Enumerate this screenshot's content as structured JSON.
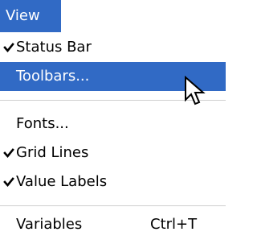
{
  "menu": {
    "title": "View",
    "items": [
      {
        "label": "Status Bar",
        "checked": true
      },
      {
        "label": "Toolbars...",
        "checked": false,
        "highlighted": true
      },
      {
        "label": "Fonts...",
        "checked": false
      },
      {
        "label": "Grid Lines",
        "checked": true
      },
      {
        "label": "Value Labels",
        "checked": true
      },
      {
        "label": "Variables",
        "checked": false,
        "shortcut": "Ctrl+T"
      }
    ]
  },
  "colors": {
    "highlight": "#316ac5",
    "text": "#000000",
    "highlight_text": "#ffffff",
    "separator": "#cfcfcf"
  },
  "icons": {
    "check": "check-icon",
    "cursor": "mouse-pointer-icon"
  }
}
